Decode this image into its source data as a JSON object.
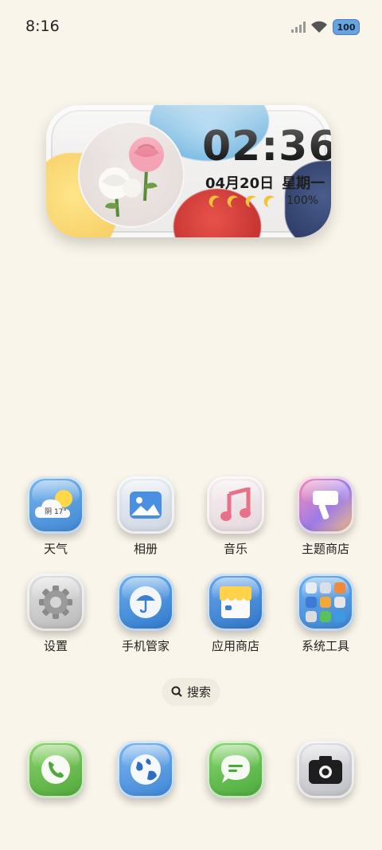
{
  "status": {
    "time": "8:16",
    "battery": "100"
  },
  "widget": {
    "time": "02:36",
    "date": "04月20日",
    "weekday": "星期一",
    "battery_pct": "100%"
  },
  "weather_icon_text": "阴 17°",
  "apps_row1": [
    {
      "label": "天气",
      "icon": "weather-icon"
    },
    {
      "label": "相册",
      "icon": "gallery-icon"
    },
    {
      "label": "音乐",
      "icon": "music-icon"
    },
    {
      "label": "主题商店",
      "icon": "theme-store-icon"
    }
  ],
  "apps_row2": [
    {
      "label": "设置",
      "icon": "settings-icon"
    },
    {
      "label": "手机管家",
      "icon": "phone-manager-icon"
    },
    {
      "label": "应用商店",
      "icon": "app-store-icon"
    },
    {
      "label": "系统工具",
      "icon": "system-tools-folder-icon"
    }
  ],
  "search": {
    "label": "搜索"
  },
  "dock": [
    {
      "icon": "phone-icon"
    },
    {
      "icon": "browser-icon"
    },
    {
      "icon": "messages-icon"
    },
    {
      "icon": "camera-icon"
    }
  ],
  "colors": {
    "background": "#faf5ea",
    "accent_blue": "#3e86d3"
  }
}
